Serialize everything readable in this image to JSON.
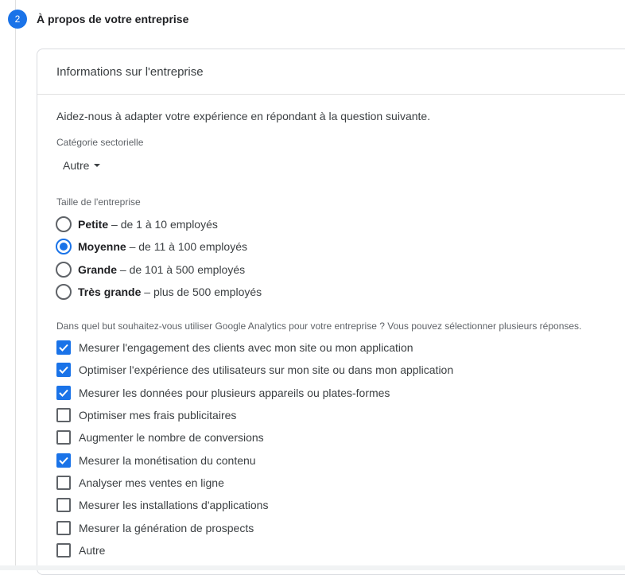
{
  "step": {
    "number": "2",
    "title": "À propos de votre entreprise"
  },
  "card": {
    "header": "Informations sur l'entreprise",
    "intro": "Aidez-nous à adapter votre expérience en répondant à la question suivante.",
    "category_label": "Catégorie sectorielle",
    "category_value": "Autre",
    "size_label": "Taille de l'entreprise",
    "size_options": [
      {
        "name": "Petite",
        "desc": " – de 1 à 10 employés",
        "checked": false
      },
      {
        "name": "Moyenne",
        "desc": " – de 11 à 100 employés",
        "checked": true
      },
      {
        "name": "Grande",
        "desc": " – de 101 à 500 employés",
        "checked": false
      },
      {
        "name": "Très grande",
        "desc": " – plus de 500 employés",
        "checked": false
      }
    ],
    "purpose_label": "Dans quel but souhaitez-vous utiliser Google Analytics pour votre entreprise ? Vous pouvez sélectionner plusieurs réponses.",
    "purposes": [
      {
        "label": "Mesurer l'engagement des clients avec mon site ou mon application",
        "checked": true
      },
      {
        "label": "Optimiser l'expérience des utilisateurs sur mon site ou dans mon application",
        "checked": true
      },
      {
        "label": "Mesurer les données pour plusieurs appareils ou plates-formes",
        "checked": true
      },
      {
        "label": "Optimiser mes frais publicitaires",
        "checked": false
      },
      {
        "label": "Augmenter le nombre de conversions",
        "checked": false
      },
      {
        "label": "Mesurer la monétisation du contenu",
        "checked": true
      },
      {
        "label": "Analyser mes ventes en ligne",
        "checked": false
      },
      {
        "label": "Mesurer les installations d'applications",
        "checked": false
      },
      {
        "label": "Mesurer la génération de prospects",
        "checked": false
      },
      {
        "label": "Autre",
        "checked": false
      }
    ]
  },
  "colors": {
    "accent": "#1a73e8",
    "border": "#dadce0",
    "text": "#3c4043"
  }
}
